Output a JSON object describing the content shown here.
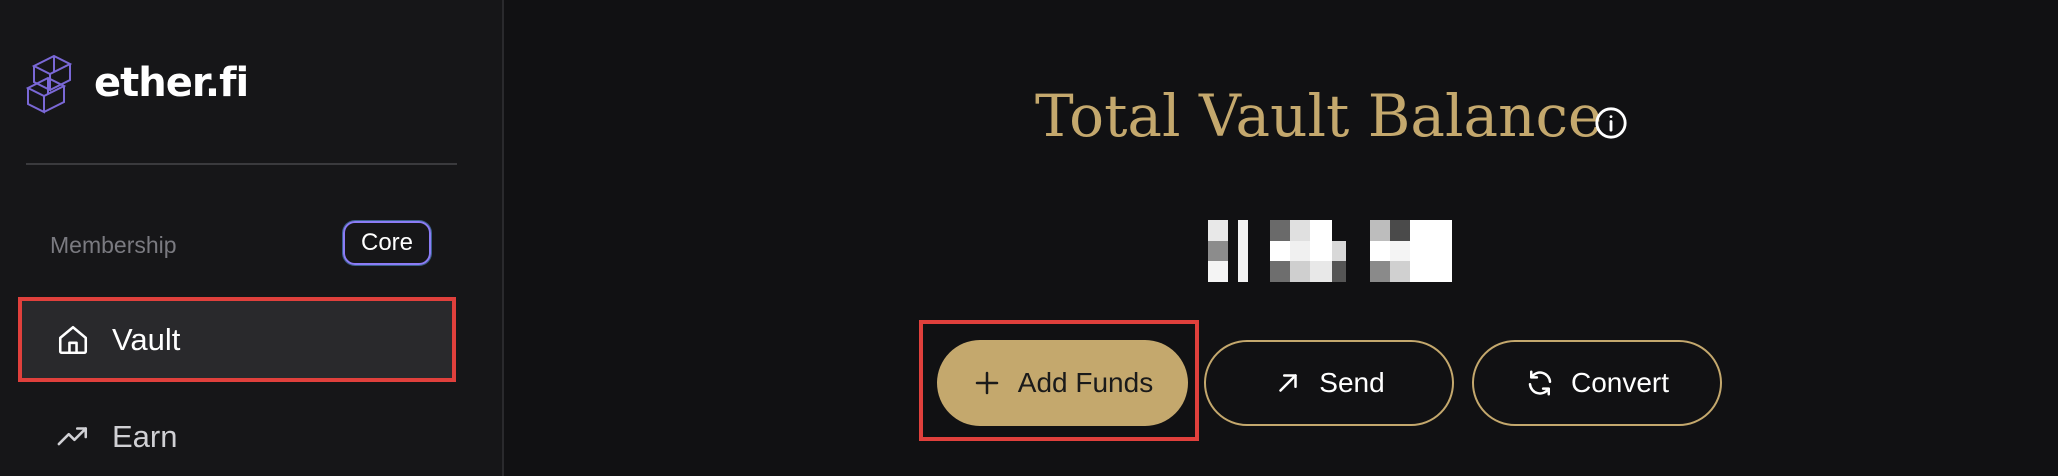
{
  "sidebar": {
    "logo_text": "ether.fi",
    "membership_label": "Membership",
    "membership_tier": "Core",
    "nav": [
      {
        "label": "Vault",
        "icon": "home-icon",
        "active": true
      },
      {
        "label": "Earn",
        "icon": "trending-up-icon",
        "active": false
      }
    ]
  },
  "main": {
    "title": "Total Vault Balance",
    "actions": {
      "add_funds": "Add Funds",
      "send": "Send",
      "convert": "Convert"
    }
  },
  "colors": {
    "accent_gold": "#c4a86d",
    "background": "#111113",
    "sidebar_bg": "#161618",
    "highlight_red": "#e0403c",
    "badge_border": "#8b7cf6"
  }
}
